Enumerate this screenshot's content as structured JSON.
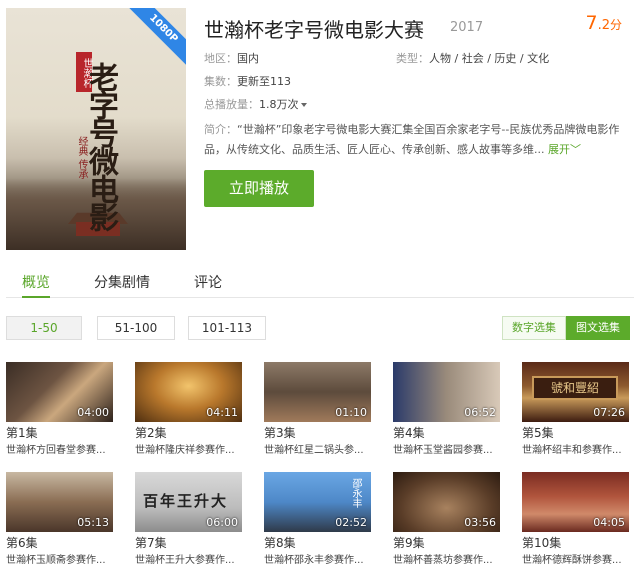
{
  "poster": {
    "badge": "1080P",
    "seal_text": "世瀚杯",
    "calligraphy": "老字号微电影",
    "subtitle": "经典 传承"
  },
  "title": "世瀚杯老字号微电影大赛",
  "year": "2017",
  "score": {
    "int": "7",
    "dec": ".2",
    "unit": "分"
  },
  "meta": {
    "region_label": "地区：",
    "region": "国内",
    "genre_label": "类型：",
    "genre": "人物 / 社会 / 历史 / 文化",
    "episodes_label": "集数：",
    "episodes": "更新至113",
    "plays_label": "总播放量：",
    "plays": "1.8万次"
  },
  "desc": {
    "label": "简介：",
    "text": "“世瀚杯”印象老字号微电影大赛汇集全国百余家老字号--民族优秀品牌微电影作品，从传统文化、品质生活、匠人匠心、传承创新、感人故事等多维...",
    "expand": "展开"
  },
  "play_button": "立即播放",
  "tabs": [
    "概览",
    "分集剧情",
    "评论"
  ],
  "ranges": [
    "1-50",
    "51-100",
    "101-113"
  ],
  "view_toggle": {
    "numeric": "数字选集",
    "picture": "图文选集"
  },
  "episodes": [
    {
      "num": "第1集",
      "name": "世瀚杯方回春堂参赛...",
      "dur": "04:00"
    },
    {
      "num": "第2集",
      "name": "世瀚杯隆庆祥参赛作...",
      "dur": "04:11"
    },
    {
      "num": "第3集",
      "name": "世瀚杯红星二锅头参...",
      "dur": "01:10"
    },
    {
      "num": "第4集",
      "name": "世瀚杯玉堂酱园参赛...",
      "dur": "06:52"
    },
    {
      "num": "第5集",
      "name": "世瀚杯绍丰和参赛作...",
      "dur": "07:26"
    },
    {
      "num": "第6集",
      "name": "世瀚杯玉顺斋参赛作...",
      "dur": "05:13"
    },
    {
      "num": "第7集",
      "name": "世瀚杯王升大参赛作...",
      "dur": "06:00"
    },
    {
      "num": "第8集",
      "name": "世瀚杯邵永丰参赛作...",
      "dur": "02:52"
    },
    {
      "num": "第9集",
      "name": "世瀚杯善蒸坊参赛作...",
      "dur": "03:56"
    },
    {
      "num": "第10集",
      "name": "世瀚杯德辉酥饼参赛...",
      "dur": "04:05"
    }
  ],
  "thumb_text": {
    "ep5": "號和豐紹",
    "ep7": "百年王升大",
    "ep8": "邵永丰"
  }
}
